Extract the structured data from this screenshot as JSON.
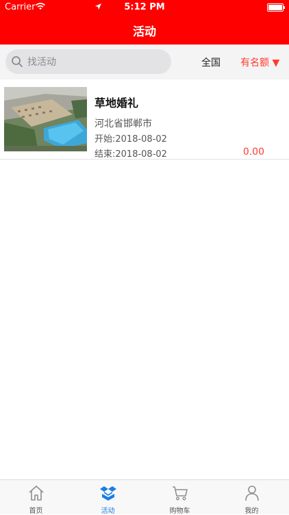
{
  "status_bar": {
    "carrier": "Carrier",
    "time": "5:12 PM"
  },
  "nav": {
    "title": "活动"
  },
  "filter": {
    "search_placeholder": "找活动",
    "region": "全国",
    "quota": "有名额 ▼"
  },
  "activities": [
    {
      "title": "草地婚礼",
      "location": "河北省邯郸市",
      "start": "开始:2018-08-02",
      "end": "结束:2018-08-02",
      "price": "0.00"
    }
  ],
  "tabs": [
    {
      "label": "首页",
      "icon": "home-icon"
    },
    {
      "label": "活动",
      "icon": "box-icon",
      "active": true
    },
    {
      "label": "购物车",
      "icon": "cart-icon"
    },
    {
      "label": "我的",
      "icon": "user-icon"
    }
  ],
  "colors": {
    "brand": "#ff0000",
    "accent": "#ff3b30",
    "active_tab": "#1a7ee6"
  }
}
